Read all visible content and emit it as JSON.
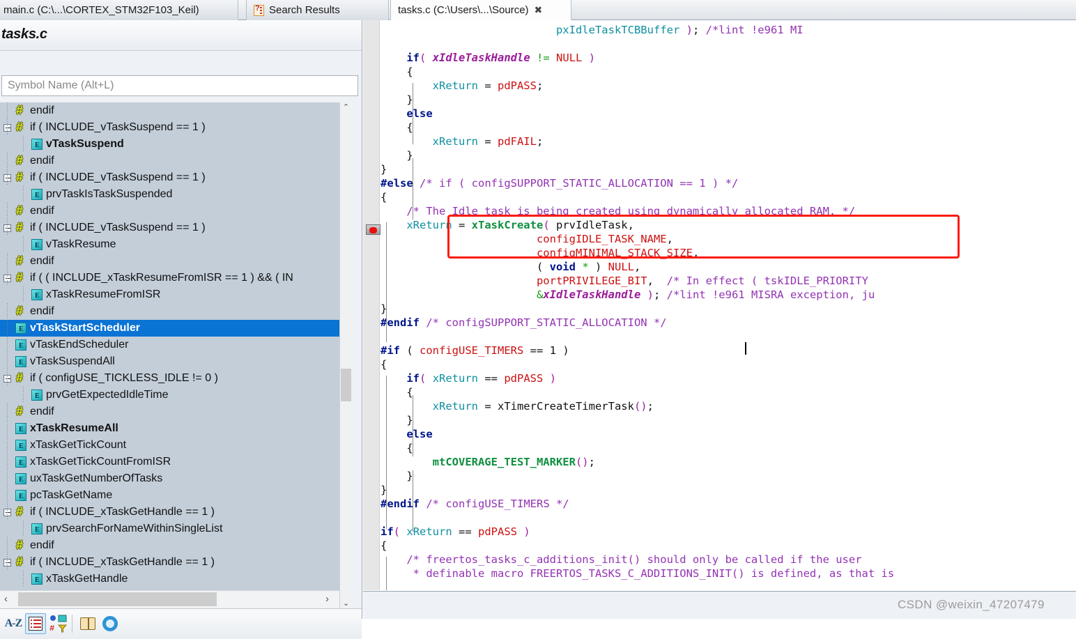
{
  "tabs": [
    {
      "label": "main.c (C:\\...\\CORTEX_STM32F103_Keil)",
      "state": "inactive",
      "icon": ""
    },
    {
      "label": "Search Results",
      "state": "inactive",
      "icon": "search-results-icon"
    },
    {
      "label": "tasks.c (C:\\Users\\...\\Source)",
      "state": "active",
      "close": "✖"
    }
  ],
  "symbol_panel": {
    "title": "tasks.c",
    "search_placeholder": "Symbol Name (Alt+L)",
    "search_value": "",
    "tree": [
      {
        "label": "endif",
        "icon": "hash-icon",
        "depth": 1,
        "expander": false,
        "bold": false,
        "selected": false
      },
      {
        "label": "if ( INCLUDE_vTaskSuspend == 1 )",
        "icon": "hash-icon",
        "depth": 1,
        "expander": true,
        "bold": false,
        "selected": false
      },
      {
        "label": "vTaskSuspend",
        "icon": "function-icon",
        "depth": 2,
        "expander": false,
        "bold": true,
        "selected": false
      },
      {
        "label": "endif",
        "icon": "hash-icon",
        "depth": 1,
        "expander": false,
        "bold": false,
        "selected": false
      },
      {
        "label": "if ( INCLUDE_vTaskSuspend == 1 )",
        "icon": "hash-icon",
        "depth": 1,
        "expander": true,
        "bold": false,
        "selected": false
      },
      {
        "label": "prvTaskIsTaskSuspended",
        "icon": "function-icon",
        "depth": 2,
        "expander": false,
        "bold": false,
        "selected": false
      },
      {
        "label": "endif",
        "icon": "hash-icon",
        "depth": 1,
        "expander": false,
        "bold": false,
        "selected": false
      },
      {
        "label": "if ( INCLUDE_vTaskSuspend == 1 )",
        "icon": "hash-icon",
        "depth": 1,
        "expander": true,
        "bold": false,
        "selected": false
      },
      {
        "label": "vTaskResume",
        "icon": "function-icon",
        "depth": 2,
        "expander": false,
        "bold": false,
        "selected": false
      },
      {
        "label": "endif",
        "icon": "hash-icon",
        "depth": 1,
        "expander": false,
        "bold": false,
        "selected": false
      },
      {
        "label": "if ( ( INCLUDE_xTaskResumeFromISR == 1 ) && ( IN",
        "icon": "hash-icon",
        "depth": 1,
        "expander": true,
        "bold": false,
        "selected": false
      },
      {
        "label": "xTaskResumeFromISR",
        "icon": "function-icon",
        "depth": 2,
        "expander": false,
        "bold": false,
        "selected": false
      },
      {
        "label": "endif",
        "icon": "hash-icon",
        "depth": 1,
        "expander": false,
        "bold": false,
        "selected": false
      },
      {
        "label": "vTaskStartScheduler",
        "icon": "function-icon",
        "depth": 1,
        "expander": false,
        "bold": true,
        "selected": true
      },
      {
        "label": "vTaskEndScheduler",
        "icon": "function-icon",
        "depth": 1,
        "expander": false,
        "bold": false,
        "selected": false
      },
      {
        "label": "vTaskSuspendAll",
        "icon": "function-icon",
        "depth": 1,
        "expander": false,
        "bold": false,
        "selected": false
      },
      {
        "label": "if ( configUSE_TICKLESS_IDLE != 0 )",
        "icon": "hash-icon",
        "depth": 1,
        "expander": true,
        "bold": false,
        "selected": false
      },
      {
        "label": "prvGetExpectedIdleTime",
        "icon": "function-icon",
        "depth": 2,
        "expander": false,
        "bold": false,
        "selected": false
      },
      {
        "label": "endif",
        "icon": "hash-icon",
        "depth": 1,
        "expander": false,
        "bold": false,
        "selected": false
      },
      {
        "label": "xTaskResumeAll",
        "icon": "function-icon",
        "depth": 1,
        "expander": false,
        "bold": true,
        "selected": false
      },
      {
        "label": "xTaskGetTickCount",
        "icon": "function-icon",
        "depth": 1,
        "expander": false,
        "bold": false,
        "selected": false
      },
      {
        "label": "xTaskGetTickCountFromISR",
        "icon": "function-icon",
        "depth": 1,
        "expander": false,
        "bold": false,
        "selected": false
      },
      {
        "label": "uxTaskGetNumberOfTasks",
        "icon": "function-icon",
        "depth": 1,
        "expander": false,
        "bold": false,
        "selected": false
      },
      {
        "label": "pcTaskGetName",
        "icon": "function-icon",
        "depth": 1,
        "expander": false,
        "bold": false,
        "selected": false
      },
      {
        "label": "if ( INCLUDE_xTaskGetHandle == 1 )",
        "icon": "hash-icon",
        "depth": 1,
        "expander": true,
        "bold": false,
        "selected": false
      },
      {
        "label": "prvSearchForNameWithinSingleList",
        "icon": "function-icon",
        "depth": 2,
        "expander": false,
        "bold": false,
        "selected": false
      },
      {
        "label": "endif",
        "icon": "hash-icon",
        "depth": 1,
        "expander": false,
        "bold": false,
        "selected": false
      },
      {
        "label": "if ( INCLUDE_xTaskGetHandle == 1 )",
        "icon": "hash-icon",
        "depth": 1,
        "expander": true,
        "bold": false,
        "selected": false
      },
      {
        "label": "xTaskGetHandle",
        "icon": "function-icon",
        "depth": 2,
        "expander": false,
        "bold": false,
        "selected": false
      }
    ],
    "toolbar": [
      {
        "name": "sort-alphabetical-button",
        "label": "A-Z",
        "selected": false
      },
      {
        "name": "list-view-button",
        "label": "",
        "selected": true
      },
      {
        "name": "filter-symbols-button",
        "label": "",
        "selected": false
      },
      {
        "name": "book-reference-button",
        "label": "",
        "selected": false
      },
      {
        "name": "settings-gear-button",
        "label": "",
        "selected": false
      }
    ],
    "scroll_left_arrow": "‹",
    "scroll_right_arrow": "›",
    "scroll_up_arrow": "⌃",
    "scroll_down_arrow": "⌄"
  },
  "editor": {
    "filename": "tasks.c",
    "annotation": {
      "shape": "rectangle",
      "color": "#fb1a0c"
    },
    "gutter_marker": "bookmark-icon",
    "scroll_up_arrow": "⌃",
    "hscroll_left_arrow": "‹"
  },
  "code_lines": [
    {
      "indent": 27,
      "tokens": [
        {
          "t": "pxIdleTaskTCBBuffer",
          "c": "var"
        },
        {
          "t": " ",
          "c": "pl"
        },
        {
          "t": ")",
          "c": "punc"
        },
        {
          "t": "; ",
          "c": "pl"
        },
        {
          "t": "/*lint !e961 MI",
          "c": "cm"
        }
      ]
    },
    {
      "indent": 0,
      "tokens": []
    },
    {
      "indent": 4,
      "tokens": [
        {
          "t": "if",
          "c": "kw"
        },
        {
          "t": "(",
          "c": "punc"
        },
        {
          "t": " ",
          "c": "pl"
        },
        {
          "t": "xIdleTaskHandle",
          "c": "vari"
        },
        {
          "t": " ",
          "c": "pl"
        },
        {
          "t": "!=",
          "c": "op"
        },
        {
          "t": " ",
          "c": "pl"
        },
        {
          "t": "NULL",
          "c": "mac"
        },
        {
          "t": " ",
          "c": "pl"
        },
        {
          "t": ")",
          "c": "punc"
        }
      ]
    },
    {
      "indent": 4,
      "tokens": [
        {
          "t": "{",
          "c": "pl"
        }
      ]
    },
    {
      "indent": 8,
      "tokens": [
        {
          "t": "xReturn",
          "c": "var"
        },
        {
          "t": " = ",
          "c": "pl"
        },
        {
          "t": "pdPASS",
          "c": "mac"
        },
        {
          "t": ";",
          "c": "pl"
        }
      ]
    },
    {
      "indent": 4,
      "tokens": [
        {
          "t": "}",
          "c": "pl"
        }
      ]
    },
    {
      "indent": 4,
      "tokens": [
        {
          "t": "else",
          "c": "kw"
        }
      ]
    },
    {
      "indent": 4,
      "tokens": [
        {
          "t": "{",
          "c": "pl"
        }
      ]
    },
    {
      "indent": 8,
      "tokens": [
        {
          "t": "xReturn",
          "c": "var"
        },
        {
          "t": " = ",
          "c": "pl"
        },
        {
          "t": "pdFAIL",
          "c": "mac"
        },
        {
          "t": ";",
          "c": "pl"
        }
      ]
    },
    {
      "indent": 4,
      "tokens": [
        {
          "t": "}",
          "c": "pl"
        }
      ]
    },
    {
      "indent": 0,
      "tokens": [
        {
          "t": "}",
          "c": "pl"
        }
      ]
    },
    {
      "indent": 0,
      "tokens": [
        {
          "t": "#else",
          "c": "pp"
        },
        {
          "t": " ",
          "c": "pl"
        },
        {
          "t": "/* if ( configSUPPORT_STATIC_ALLOCATION == 1 ) */",
          "c": "cm"
        }
      ]
    },
    {
      "indent": 0,
      "tokens": [
        {
          "t": "{",
          "c": "pl"
        }
      ]
    },
    {
      "indent": 4,
      "tokens": [
        {
          "t": "/* The Idle task is being created using dynamically allocated RAM. */",
          "c": "cm"
        }
      ]
    },
    {
      "indent": 4,
      "tokens": [
        {
          "t": "xReturn",
          "c": "var"
        },
        {
          "t": " = ",
          "c": "pl"
        },
        {
          "t": "xTaskCreate",
          "c": "fn"
        },
        {
          "t": "(",
          "c": "punc"
        },
        {
          "t": " prvIdleTask,",
          "c": "pl"
        }
      ]
    },
    {
      "indent": 24,
      "tokens": [
        {
          "t": "configIDLE_TASK_NAME",
          "c": "mac"
        },
        {
          "t": ",",
          "c": "pl"
        }
      ]
    },
    {
      "indent": 24,
      "tokens": [
        {
          "t": "configMINIMAL_STACK_SIZE",
          "c": "mac"
        },
        {
          "t": ",",
          "c": "pl"
        }
      ]
    },
    {
      "indent": 24,
      "tokens": [
        {
          "t": "( ",
          "c": "pl"
        },
        {
          "t": "void",
          "c": "kw"
        },
        {
          "t": " ",
          "c": "pl"
        },
        {
          "t": "*",
          "c": "op"
        },
        {
          "t": " ) ",
          "c": "pl"
        },
        {
          "t": "NULL",
          "c": "mac"
        },
        {
          "t": ",",
          "c": "pl"
        }
      ]
    },
    {
      "indent": 24,
      "tokens": [
        {
          "t": "portPRIVILEGE_BIT",
          "c": "mac"
        },
        {
          "t": ",  ",
          "c": "pl"
        },
        {
          "t": "/* In effect ( tskIDLE_PRIORITY",
          "c": "cm"
        }
      ]
    },
    {
      "indent": 24,
      "tokens": [
        {
          "t": "&",
          "c": "op"
        },
        {
          "t": "xIdleTaskHandle",
          "c": "vari"
        },
        {
          "t": " ",
          "c": "pl"
        },
        {
          "t": ")",
          "c": "punc"
        },
        {
          "t": "; ",
          "c": "pl"
        },
        {
          "t": "/*lint !e961 MISRA exception, ju",
          "c": "cm"
        }
      ]
    },
    {
      "indent": 0,
      "tokens": [
        {
          "t": "}",
          "c": "pl"
        }
      ]
    },
    {
      "indent": 0,
      "tokens": [
        {
          "t": "#endif",
          "c": "pp"
        },
        {
          "t": " ",
          "c": "pl"
        },
        {
          "t": "/* configSUPPORT_STATIC_ALLOCATION */",
          "c": "cm"
        }
      ]
    },
    {
      "indent": 0,
      "tokens": []
    },
    {
      "indent": 0,
      "tokens": [
        {
          "t": "#if",
          "c": "pp"
        },
        {
          "t": " ",
          "c": "pl"
        },
        {
          "t": "( ",
          "c": "pl"
        },
        {
          "t": "configUSE_TIMERS",
          "c": "mac"
        },
        {
          "t": " == ",
          "c": "pl"
        },
        {
          "t": "1",
          "c": "pl"
        },
        {
          "t": " )",
          "c": "pl"
        }
      ]
    },
    {
      "indent": 0,
      "tokens": [
        {
          "t": "{",
          "c": "pl"
        }
      ]
    },
    {
      "indent": 4,
      "tokens": [
        {
          "t": "if",
          "c": "kw"
        },
        {
          "t": "(",
          "c": "punc"
        },
        {
          "t": " ",
          "c": "pl"
        },
        {
          "t": "xReturn",
          "c": "var"
        },
        {
          "t": " == ",
          "c": "pl"
        },
        {
          "t": "pdPASS",
          "c": "mac"
        },
        {
          "t": " ",
          "c": "pl"
        },
        {
          "t": ")",
          "c": "punc"
        }
      ]
    },
    {
      "indent": 4,
      "tokens": [
        {
          "t": "{",
          "c": "pl"
        }
      ]
    },
    {
      "indent": 8,
      "tokens": [
        {
          "t": "xReturn",
          "c": "var"
        },
        {
          "t": " = xTimerCreateTimerTask",
          "c": "pl"
        },
        {
          "t": "()",
          "c": "punc"
        },
        {
          "t": ";",
          "c": "pl"
        }
      ]
    },
    {
      "indent": 4,
      "tokens": [
        {
          "t": "}",
          "c": "pl"
        }
      ]
    },
    {
      "indent": 4,
      "tokens": [
        {
          "t": "else",
          "c": "kw"
        }
      ]
    },
    {
      "indent": 4,
      "tokens": [
        {
          "t": "{",
          "c": "pl"
        }
      ]
    },
    {
      "indent": 8,
      "tokens": [
        {
          "t": "mtCOVERAGE_TEST_MARKER",
          "c": "fn"
        },
        {
          "t": "()",
          "c": "punc"
        },
        {
          "t": ";",
          "c": "pl"
        }
      ]
    },
    {
      "indent": 4,
      "tokens": [
        {
          "t": "}",
          "c": "pl"
        }
      ]
    },
    {
      "indent": 0,
      "tokens": [
        {
          "t": "}",
          "c": "pl"
        }
      ]
    },
    {
      "indent": 0,
      "tokens": [
        {
          "t": "#endif",
          "c": "pp"
        },
        {
          "t": " ",
          "c": "pl"
        },
        {
          "t": "/* configUSE_TIMERS */",
          "c": "cm"
        }
      ]
    },
    {
      "indent": 0,
      "tokens": []
    },
    {
      "indent": 0,
      "tokens": [
        {
          "t": "if",
          "c": "kw"
        },
        {
          "t": "(",
          "c": "punc"
        },
        {
          "t": " ",
          "c": "pl"
        },
        {
          "t": "xReturn",
          "c": "var"
        },
        {
          "t": " == ",
          "c": "pl"
        },
        {
          "t": "pdPASS",
          "c": "mac"
        },
        {
          "t": " ",
          "c": "pl"
        },
        {
          "t": ")",
          "c": "punc"
        }
      ]
    },
    {
      "indent": 0,
      "tokens": [
        {
          "t": "{",
          "c": "pl"
        }
      ]
    },
    {
      "indent": 4,
      "tokens": [
        {
          "t": "/* freertos_tasks_c_additions_init() should only be called if the user",
          "c": "cm"
        }
      ]
    },
    {
      "indent": 4,
      "tokens": [
        {
          "t": " * definable macro FREERTOS_TASKS_C_ADDITIONS_INIT() is defined, as that is",
          "c": "cm"
        }
      ]
    }
  ],
  "watermark": "CSDN @weixin_47207479"
}
